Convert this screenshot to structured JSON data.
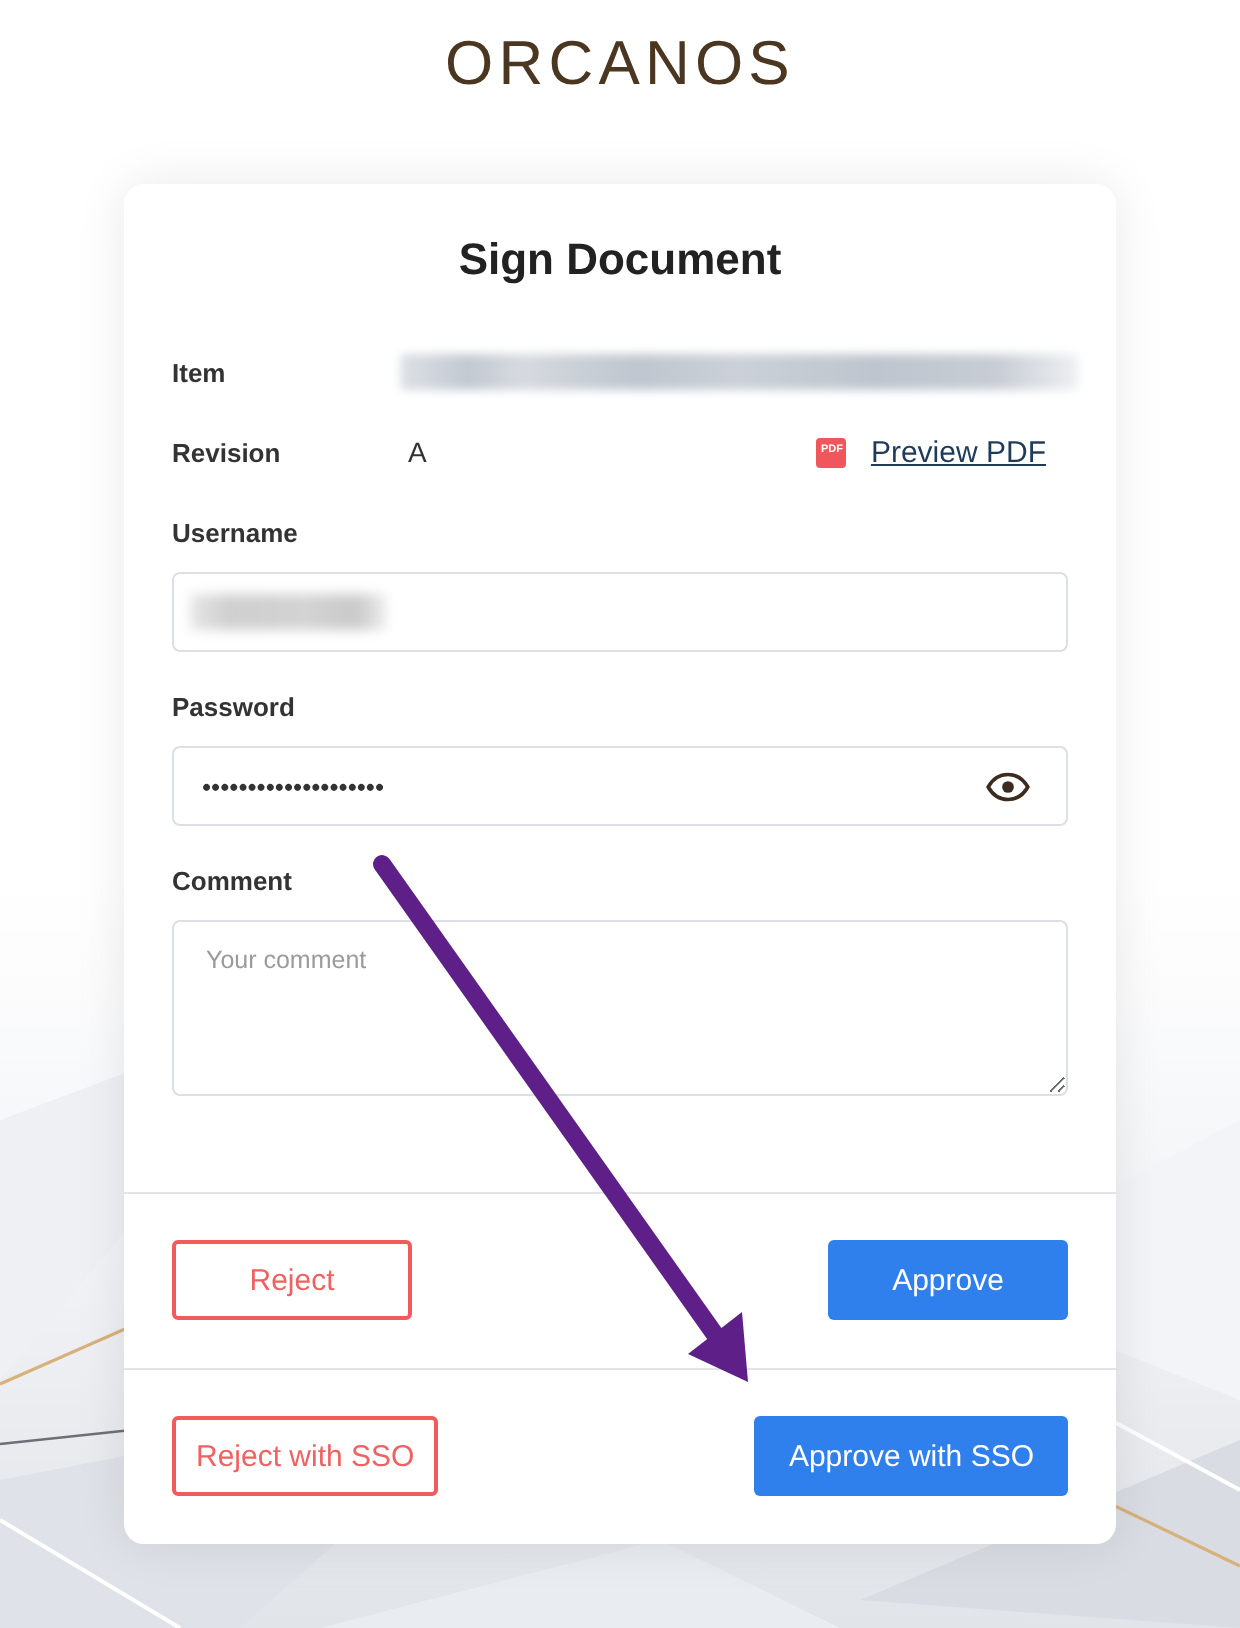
{
  "logo": {
    "text": "ORCANOS"
  },
  "dialog": {
    "title": "Sign Document",
    "details": [
      {
        "label": "Item",
        "redacted": true
      },
      {
        "label": "Revision",
        "value": "A",
        "redacted": false,
        "link": {
          "label": "Preview PDF",
          "icon_text": "PDF"
        }
      }
    ],
    "fields": [
      {
        "kind": "text",
        "label": "Username",
        "redacted": true
      },
      {
        "kind": "password",
        "label": "Password",
        "value": "••••••••••••••••••••",
        "redacted": false
      },
      {
        "kind": "textarea",
        "label": "Comment",
        "placeholder": "Your comment"
      }
    ],
    "action_rows": [
      {
        "buttons": [
          {
            "kind": "reject",
            "label": "Reject"
          },
          {
            "kind": "approve",
            "label": "Approve"
          }
        ]
      },
      {
        "buttons": [
          {
            "kind": "reject",
            "label": "Reject with SSO"
          },
          {
            "kind": "approve",
            "label": "Approve with SSO"
          }
        ]
      }
    ]
  },
  "annotations": [
    {
      "kind": "arrow"
    }
  ]
}
